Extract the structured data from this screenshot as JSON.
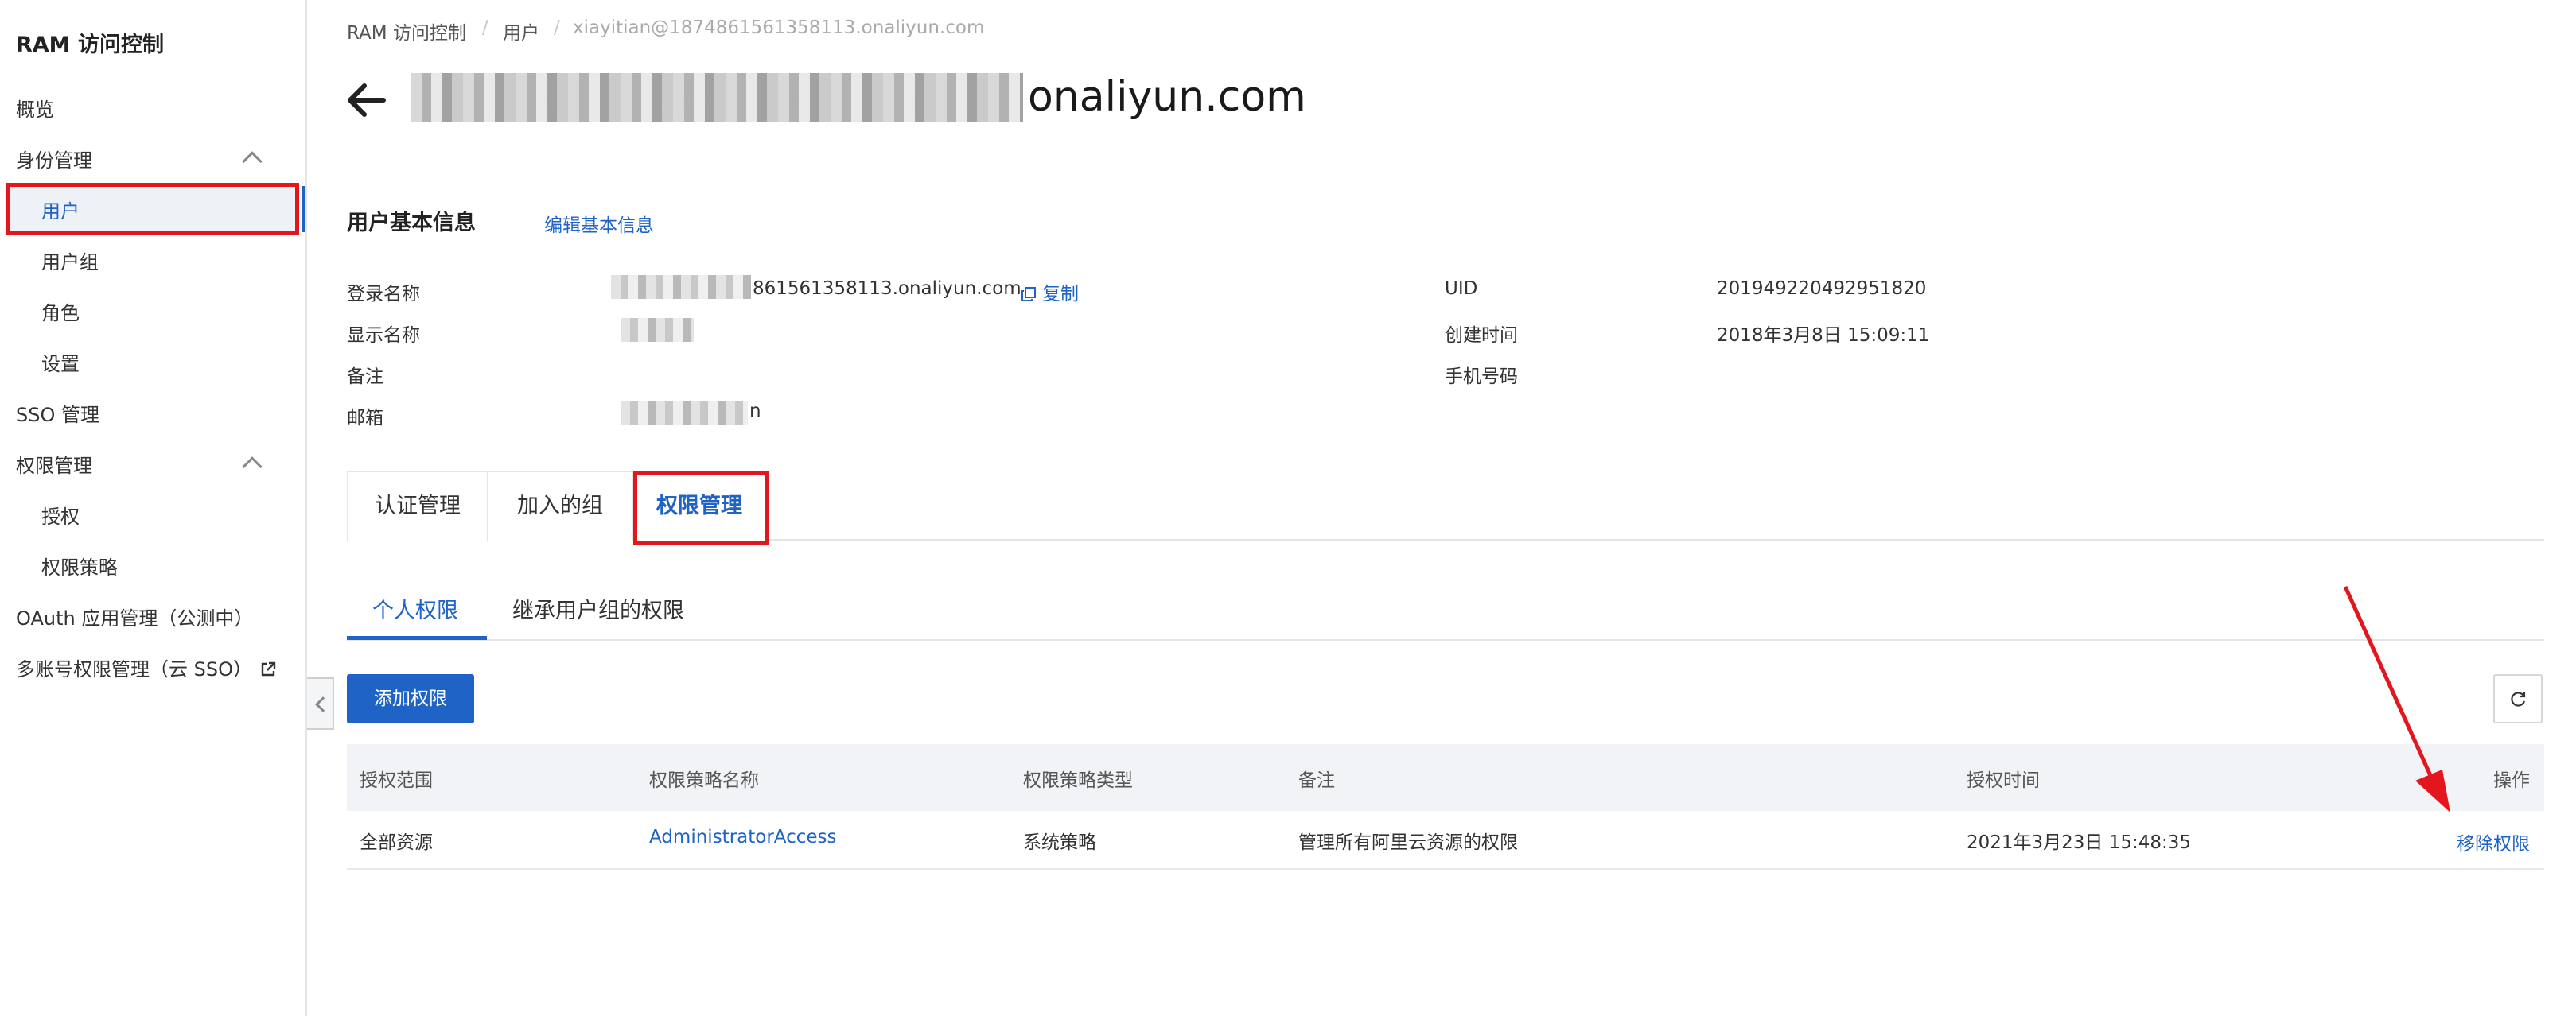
{
  "sidebar": {
    "title": "RAM 访问控制",
    "items": [
      {
        "label": "概览"
      },
      {
        "label": "身份管理"
      },
      {
        "label": "用户"
      },
      {
        "label": "用户组"
      },
      {
        "label": "角色"
      },
      {
        "label": "设置"
      },
      {
        "label": "SSO 管理"
      },
      {
        "label": "权限管理"
      },
      {
        "label": "授权"
      },
      {
        "label": "权限策略"
      },
      {
        "label": "OAuth 应用管理（公测中）"
      },
      {
        "label": "多账号权限管理（云 SSO）"
      }
    ],
    "active_item": "用户"
  },
  "breadcrumb": [
    "RAM 访问控制",
    "用户",
    "xiayitian@1874861561358113.onaliyun.com"
  ],
  "header": {
    "title_suffix": "onaliyun.com"
  },
  "basic_info": {
    "section_title": "用户基本信息",
    "edit_link": "编辑基本信息",
    "left": [
      {
        "label": "登录名称",
        "value": "861561358113.onaliyun.com",
        "copy_label": "复制"
      },
      {
        "label": "显示名称",
        "value": ""
      },
      {
        "label": "备注",
        "value": ""
      },
      {
        "label": "邮箱",
        "value": "n"
      }
    ],
    "right": [
      {
        "label": "UID",
        "value": "201949220492951820"
      },
      {
        "label": "创建时间",
        "value": "2018年3月8日 15:09:11"
      },
      {
        "label": "手机号码",
        "value": ""
      }
    ]
  },
  "tabs": [
    {
      "label": "认证管理"
    },
    {
      "label": "加入的组"
    },
    {
      "label": "权限管理"
    }
  ],
  "active_tab": "权限管理",
  "subtabs": [
    {
      "label": "个人权限"
    },
    {
      "label": "继承用户组的权限"
    }
  ],
  "active_subtab": "个人权限",
  "toolbar": {
    "add_label": "添加权限",
    "refresh_icon": "refresh-icon"
  },
  "table": {
    "columns": [
      "授权范围",
      "权限策略名称",
      "权限策略类型",
      "备注",
      "授权时间",
      "操作"
    ],
    "rows": [
      {
        "scope": "全部资源",
        "policy_name": "AdministratorAccess",
        "policy_type": "系统策略",
        "note": "管理所有阿里云资源的权限",
        "time": "2021年3月23日 15:48:35",
        "action": "移除权限"
      }
    ]
  },
  "colors": {
    "accent": "#1f63c6",
    "highlight": "#e3151d"
  }
}
